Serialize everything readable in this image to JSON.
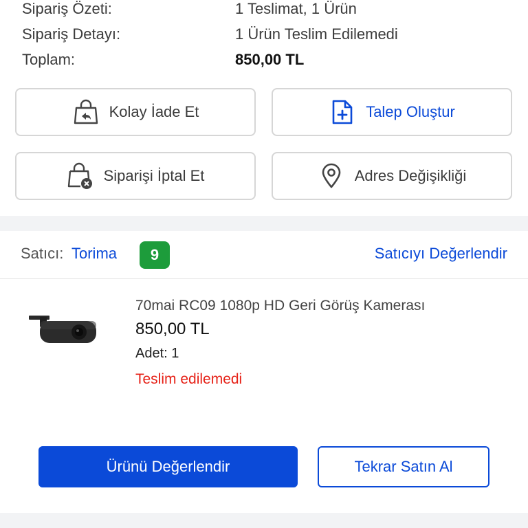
{
  "summary": {
    "rows": [
      {
        "label": "Sipariş Özeti:",
        "value": "1 Teslimat, 1 Ürün"
      },
      {
        "label": "Sipariş Detayı:",
        "value": "1 Ürün Teslim Edilemedi"
      },
      {
        "label": "Toplam:",
        "value": "850,00 TL"
      }
    ]
  },
  "actions": {
    "easy_return": "Kolay İade Et",
    "create_request": "Talep Oluştur",
    "cancel_order": "Siparişi İptal Et",
    "address_change": "Adres Değişikliği"
  },
  "seller": {
    "label": "Satıcı:",
    "name": "Torima",
    "score": "9",
    "rate_label": "Satıcıyı Değerlendir"
  },
  "product": {
    "title": "70mai RC09 1080p HD Geri Görüş Kamerası",
    "price": "850,00 TL",
    "quantity": "Adet: 1",
    "status": "Teslim edilemedi"
  },
  "buttons": {
    "rate_product": "Ürünü Değerlendir",
    "buy_again": "Tekrar Satın Al"
  },
  "colors": {
    "accent": "#0b4ad8",
    "score_badge": "#1d9c3b",
    "status_error": "#e62117"
  },
  "icons": {
    "easy_return": "shopping-bag-return-icon",
    "create_request": "document-plus-icon",
    "cancel_order": "shopping-bag-cancel-icon",
    "address_change": "location-pin-icon"
  }
}
